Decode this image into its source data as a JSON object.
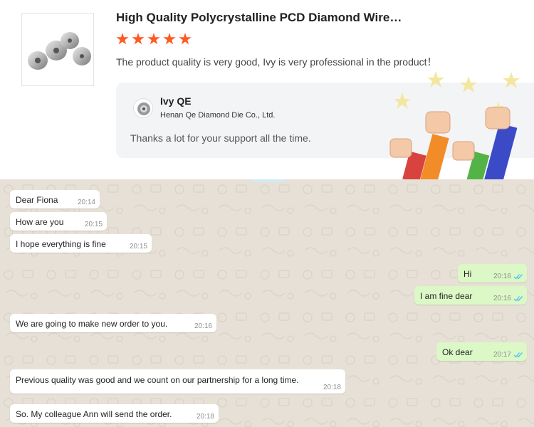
{
  "review": {
    "product_title": "High Quality Polycrystalline PCD Diamond Wire…",
    "rating": 5,
    "text": "The product quality is very good, Ivy is very professional in the product！",
    "reply": {
      "name": "Ivy QE",
      "company": "Henan Qe Diamond Die Co., Ltd.",
      "text": "Thanks a lot for your support all the time."
    }
  },
  "chat": {
    "messages": [
      {
        "dir": "in",
        "text": "Dear Fiona",
        "time": "20:14"
      },
      {
        "dir": "in",
        "text": "How are you",
        "time": "20:15"
      },
      {
        "dir": "in",
        "text": "I hope everything is fine",
        "time": "20:15"
      },
      {
        "dir": "out",
        "text": "Hi",
        "time": "20:16"
      },
      {
        "dir": "out",
        "text": "I am fine dear",
        "time": "20:16"
      },
      {
        "dir": "in",
        "text": "We are going to make new order to you.",
        "time": "20:16"
      },
      {
        "dir": "out",
        "text": "Ok dear",
        "time": "20:17"
      },
      {
        "dir": "in",
        "text": "Previous quality was good and we count on our partnership for a long time.",
        "time": "20:18"
      },
      {
        "dir": "in",
        "text": "So. My colleague Ann will send the order.",
        "time": "20:18"
      }
    ]
  },
  "colors": {
    "star": "#ff5a1f",
    "incoming_bubble": "#ffffff",
    "outgoing_bubble": "#dcf8c6",
    "chat_background": "#e7e0d6",
    "read_ticks": "#4fc3f7"
  }
}
